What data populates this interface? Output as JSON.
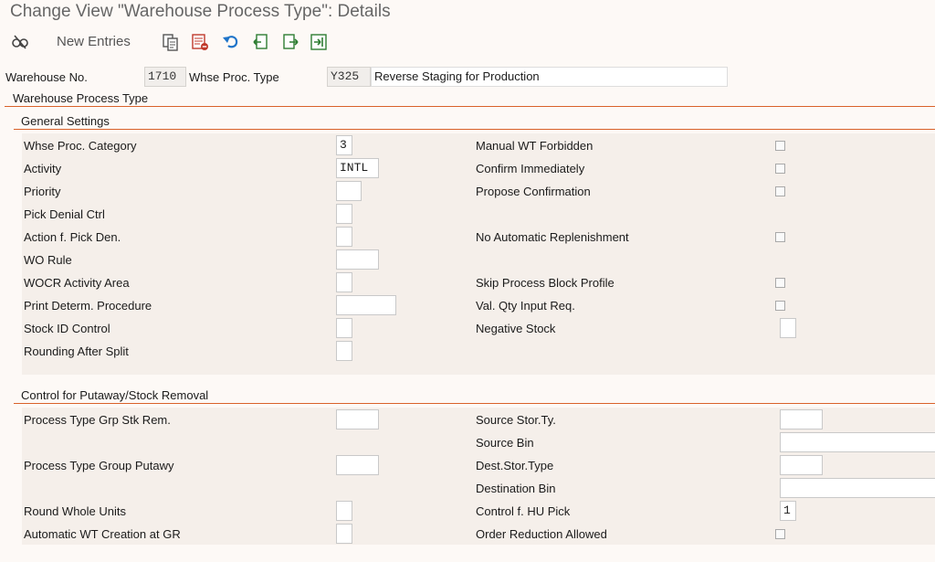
{
  "window": {
    "title": "Change View \"Warehouse Process Type\": Details"
  },
  "toolbar": {
    "new_entries_label": "New Entries",
    "icons": [
      "display-change-icon",
      "copy-icon",
      "delete-icon",
      "undo-icon",
      "previous-entry-icon",
      "next-entry-icon",
      "select-icon"
    ]
  },
  "header": {
    "warehouse_no_label": "Warehouse No.",
    "warehouse_no_value": "1710",
    "whse_proc_type_label": "Whse Proc. Type",
    "whse_proc_type_value": "Y325",
    "whse_proc_type_desc": "Reverse Staging for Production"
  },
  "group": {
    "title": "Warehouse Process Type"
  },
  "general_settings": {
    "title": "General Settings",
    "left": [
      {
        "label": "Whse Proc. Category",
        "value": "3"
      },
      {
        "label": "Activity",
        "value": "INTL"
      },
      {
        "label": "Priority",
        "value": ""
      },
      {
        "label": "Pick Denial Ctrl",
        "value": ""
      },
      {
        "label": "Action f. Pick Den.",
        "value": ""
      },
      {
        "label": "WO Rule",
        "value": ""
      },
      {
        "label": "WOCR Activity Area",
        "value": ""
      },
      {
        "label": "Print Determ. Procedure",
        "value": ""
      },
      {
        "label": "Stock ID Control",
        "value": ""
      },
      {
        "label": "Rounding After Split",
        "value": ""
      }
    ],
    "right": [
      {
        "label": "Manual WT Forbidden",
        "checked": false
      },
      {
        "label": "Confirm Immediately",
        "checked": false
      },
      {
        "label": "Propose Confirmation",
        "checked": false
      },
      {
        "label": "No Automatic Replenishment",
        "checked": false
      },
      {
        "label": "Skip Process Block Profile",
        "checked": false
      },
      {
        "label": "Val. Qty Input Req.",
        "checked": false
      },
      {
        "label": "Negative Stock",
        "value": ""
      }
    ]
  },
  "putaway_removal": {
    "title": "Control for Putaway/Stock Removal",
    "left": [
      {
        "label": "Process Type Grp Stk Rem.",
        "value": ""
      },
      {
        "label": "Process Type Group Putawy",
        "value": ""
      },
      {
        "label": "Round Whole Units",
        "value": ""
      },
      {
        "label": "Automatic WT Creation at GR",
        "value": ""
      }
    ],
    "right": [
      {
        "label": "Source Stor.Ty.",
        "value": ""
      },
      {
        "label": "Source Bin",
        "value": ""
      },
      {
        "label": "Dest.Stor.Type",
        "value": ""
      },
      {
        "label": "Destination Bin",
        "value": ""
      },
      {
        "label": "Control f. HU Pick",
        "value": "1"
      },
      {
        "label": "Order Reduction Allowed",
        "checked": false
      }
    ]
  },
  "colors": {
    "accent": "#d9612a",
    "background": "#fdf9f6",
    "field_area": "#f5efea"
  }
}
